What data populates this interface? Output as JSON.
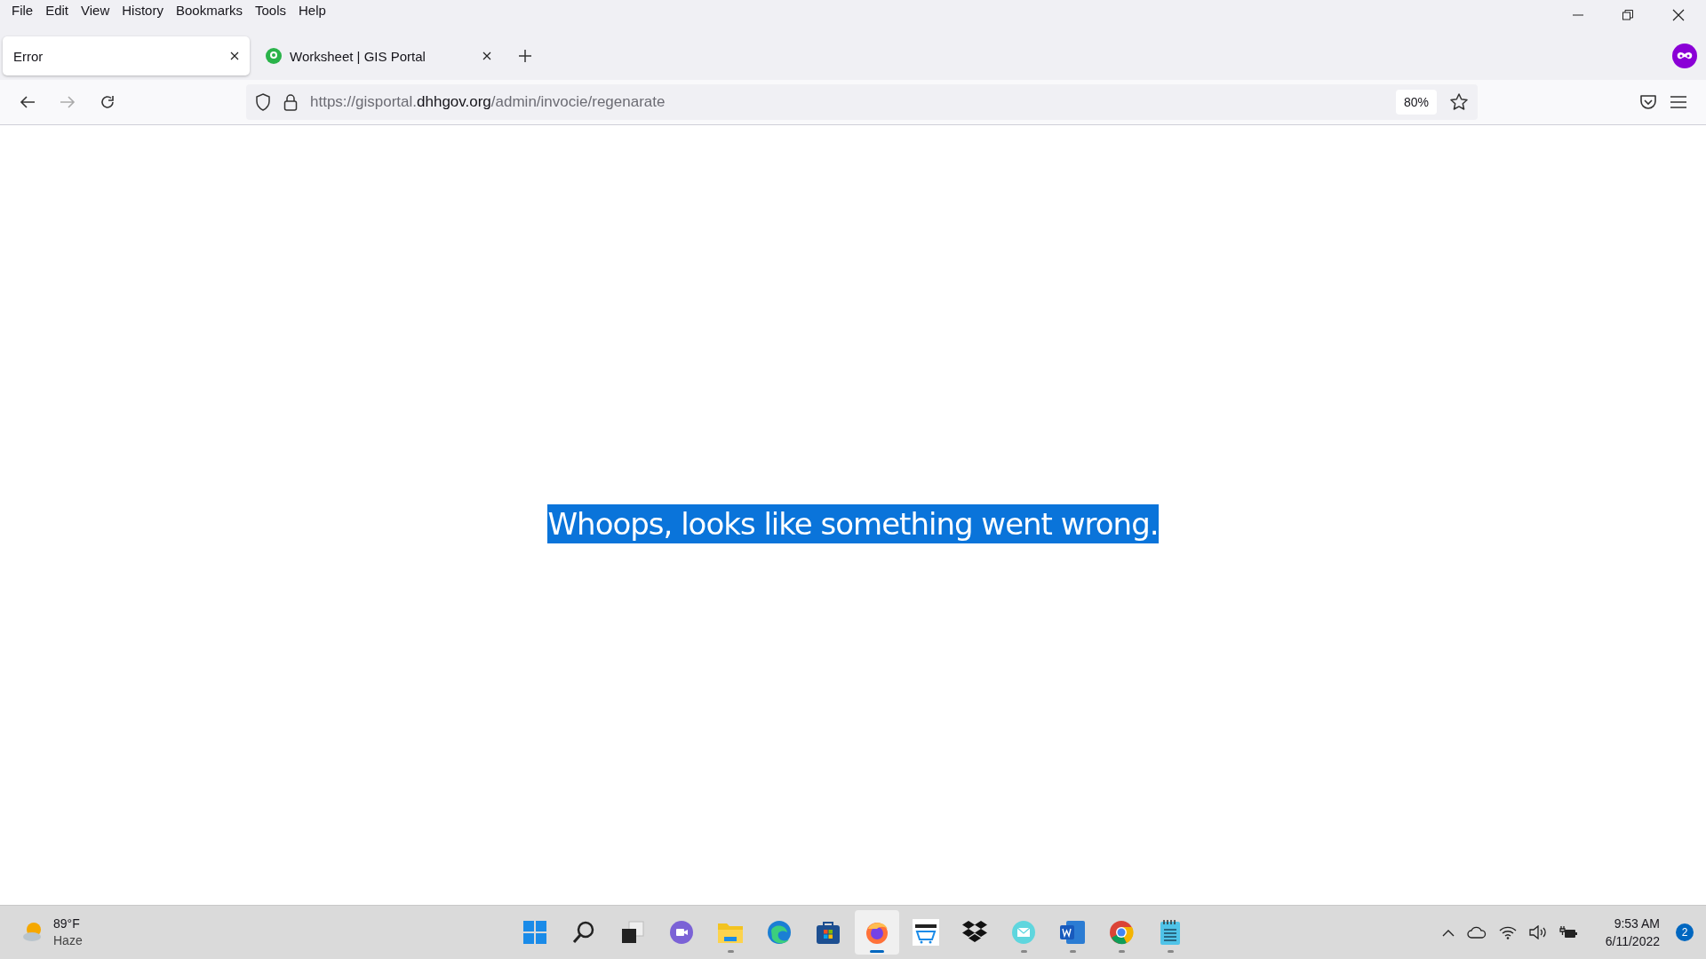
{
  "menu": [
    "File",
    "Edit",
    "View",
    "History",
    "Bookmarks",
    "Tools",
    "Help"
  ],
  "tabs": [
    {
      "title": "Error",
      "selected": true,
      "kind": "plain"
    },
    {
      "title": "Worksheet | GIS Portal",
      "selected": false,
      "kind": "favicon"
    }
  ],
  "address": {
    "prefix": "https://gisportal.",
    "domain": "dhhgov.org",
    "path": "/admin/invocie/regenarate",
    "zoom": "80%"
  },
  "page": {
    "message": "Whoops, looks like something went wrong.",
    "selected": true
  },
  "weather": {
    "temperature": "89°F",
    "condition": "Haze"
  },
  "taskbar": [
    {
      "kind": "start",
      "running": false,
      "selected": false
    },
    {
      "kind": "search",
      "running": false,
      "selected": false
    },
    {
      "kind": "taskview",
      "running": false,
      "selected": false
    },
    {
      "kind": "chat",
      "running": false,
      "selected": false
    },
    {
      "kind": "folder",
      "running": true,
      "selected": false
    },
    {
      "kind": "edge",
      "running": false,
      "selected": false
    },
    {
      "kind": "store",
      "running": false,
      "selected": false
    },
    {
      "kind": "firefox",
      "running": true,
      "selected": true
    },
    {
      "kind": "amazon",
      "running": false,
      "selected": false
    },
    {
      "kind": "dropbox",
      "running": false,
      "selected": false
    },
    {
      "kind": "mail",
      "running": true,
      "selected": false
    },
    {
      "kind": "word",
      "running": true,
      "selected": false
    },
    {
      "kind": "chrome",
      "running": true,
      "selected": false
    },
    {
      "kind": "notepad",
      "running": true,
      "selected": false
    }
  ],
  "clock": {
    "time": "9:53 AM",
    "date": "6/11/2022",
    "notifications": "2"
  }
}
